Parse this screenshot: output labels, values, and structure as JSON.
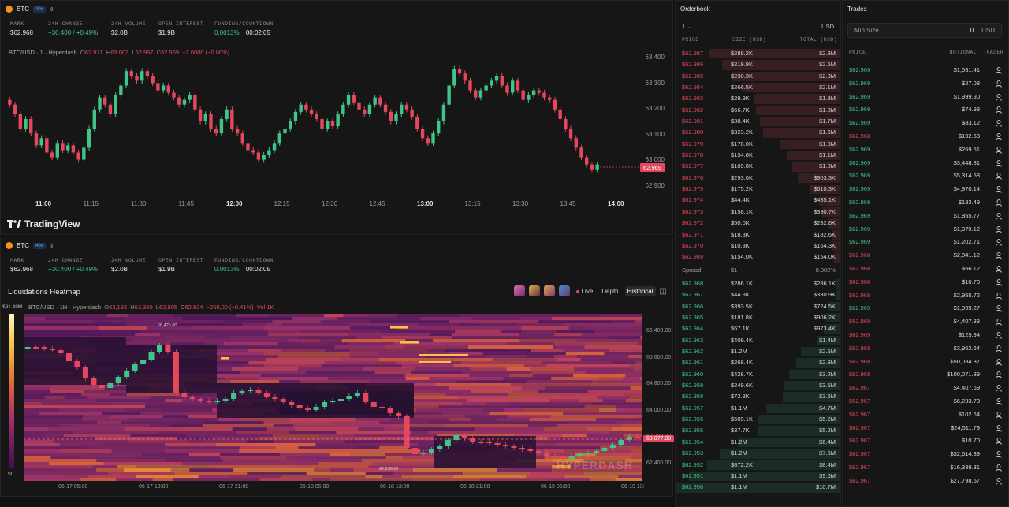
{
  "chart1": {
    "symbol": "BTC",
    "leverage": "40x",
    "stats": [
      {
        "label": "MARK",
        "value": "$62.968",
        "color": "white"
      },
      {
        "label": "24H CHANGE",
        "value": "+30.400 / +0.49%",
        "color": "green"
      },
      {
        "label": "24H VOLUME",
        "value": "$2.0B",
        "color": "white"
      },
      {
        "label": "OPEN INTEREST",
        "value": "$1.9B",
        "color": "white"
      },
      {
        "label": "FUNDING/COUNTDOWN",
        "value": "0.0013%",
        "value2": "00:02:05",
        "color": "green"
      }
    ],
    "ohlc": {
      "name": "BTC/USD · 1 · Hyperdash",
      "o": "62.971",
      "h": "63.003",
      "l": "62.967",
      "c": "62.969",
      "chg": "−2.0000 (−0.00%)"
    },
    "y_ticks": [
      "63.400",
      "63.300",
      "63.200",
      "63.100",
      "63.000",
      "62.900"
    ],
    "x_ticks": [
      "11:00",
      "11:15",
      "11:30",
      "11:45",
      "12:00",
      "12:15",
      "12:30",
      "12:45",
      "13:00",
      "13:15",
      "13:30",
      "13:45",
      "14:00"
    ],
    "price_tag": "62.969",
    "brand": "TradingView"
  },
  "chart2": {
    "symbol": "BTC",
    "leverage": "40x",
    "stats": [
      {
        "label": "MARK",
        "value": "$62.968",
        "color": "white"
      },
      {
        "label": "24H CHANGE",
        "value": "+30.400 / +0.49%",
        "color": "green"
      },
      {
        "label": "24H VOLUME",
        "value": "$2.0B",
        "color": "white"
      },
      {
        "label": "OPEN INTEREST",
        "value": "$1.9B",
        "color": "white"
      },
      {
        "label": "FUNDING/COUNTDOWN",
        "value": "0.0013%",
        "value2": "00:02:05",
        "color": "green"
      }
    ],
    "title": "Liquidations Heatmap",
    "controls": {
      "live": "Live",
      "depth": "Depth",
      "historical": "Historical"
    },
    "ohlc": {
      "name": "BTC/USD · 1H · Hyperdash",
      "o": "63,183",
      "h": "63,380",
      "l": "62,905",
      "c": "62,924",
      "chg": "−259,00 (−0.41%)",
      "vol": "Vol 1K"
    },
    "scale_max": "$91.49M",
    "scale_min": "$0",
    "y_ticks": [
      "66,400.00",
      "65,600.00",
      "64,800.00",
      "64,000.00",
      "63,200.00",
      "62,400.00"
    ],
    "price_tag": "63,077.00",
    "x_ticks": [
      "06-17 05:00",
      "06-17 13:00",
      "06-17 21:00",
      "06-18 05:00",
      "06-18 13:00",
      "06-18 21:00",
      "06-19 05:00",
      "06-19 13:"
    ],
    "hi_label": "66,425.00",
    "lo_label": "62,236.00",
    "watermark": "HYPERDASH"
  },
  "orderbook": {
    "title": "Orderbook",
    "group": "1",
    "unit": "USD",
    "headers": {
      "price": "PRICE",
      "size": "SIZE (USD)",
      "total": "TOTAL (USD)"
    },
    "asks": [
      {
        "price": "$62.987",
        "size": "$288.2K",
        "total": "$2.8M",
        "depth": 0.8
      },
      {
        "price": "$62.986",
        "size": "$219.9K",
        "total": "$2.5M",
        "depth": 0.72
      },
      {
        "price": "$62.985",
        "size": "$230.3K",
        "total": "$2.3M",
        "depth": 0.66
      },
      {
        "price": "$62.984",
        "size": "$266.5K",
        "total": "$2.1M",
        "depth": 0.6
      },
      {
        "price": "$62.983",
        "size": "$29.9K",
        "total": "$1.8M",
        "depth": 0.52
      },
      {
        "price": "$62.982",
        "size": "$66.7K",
        "total": "$1.8M",
        "depth": 0.51
      },
      {
        "price": "$62.981",
        "size": "$38.4K",
        "total": "$1.7M",
        "depth": 0.49
      },
      {
        "price": "$62.980",
        "size": "$323.2K",
        "total": "$1.6M",
        "depth": 0.47
      },
      {
        "price": "$62.979",
        "size": "$178.0K",
        "total": "$1.3M",
        "depth": 0.37
      },
      {
        "price": "$62.978",
        "size": "$134.8K",
        "total": "$1.1M",
        "depth": 0.32
      },
      {
        "price": "$62.977",
        "size": "$109.8K",
        "total": "$1.0M",
        "depth": 0.29
      },
      {
        "price": "$62.976",
        "size": "$293.0K",
        "total": "$903.3K",
        "depth": 0.26
      },
      {
        "price": "$62.975",
        "size": "$175.2K",
        "total": "$610.3K",
        "depth": 0.18
      },
      {
        "price": "$62.974",
        "size": "$44.4K",
        "total": "$435.1K",
        "depth": 0.13
      },
      {
        "price": "$62.973",
        "size": "$158.1K",
        "total": "$390.7K",
        "depth": 0.11
      },
      {
        "price": "$62.972",
        "size": "$50.0K",
        "total": "$232.6K",
        "depth": 0.07
      },
      {
        "price": "$62.971",
        "size": "$18.3K",
        "total": "$182.6K",
        "depth": 0.05
      },
      {
        "price": "$62.970",
        "size": "$10.3K",
        "total": "$164.3K",
        "depth": 0.05
      },
      {
        "price": "$62.969",
        "size": "$154.0K",
        "total": "$154.0K",
        "depth": 0.04
      }
    ],
    "spread": {
      "label": "Spread",
      "value": "$1",
      "pct": "0.002%"
    },
    "bids": [
      {
        "price": "$62.968",
        "size": "$286.1K",
        "total": "$286.1K",
        "depth": 0.03
      },
      {
        "price": "$62.967",
        "size": "$44.8K",
        "total": "$330.9K",
        "depth": 0.03
      },
      {
        "price": "$62.966",
        "size": "$393.5K",
        "total": "$724.5K",
        "depth": 0.07
      },
      {
        "price": "$62.965",
        "size": "$181.8K",
        "total": "$906.2K",
        "depth": 0.09
      },
      {
        "price": "$62.964",
        "size": "$67.1K",
        "total": "$973.4K",
        "depth": 0.1
      },
      {
        "price": "$62.963",
        "size": "$409.4K",
        "total": "$1.4M",
        "depth": 0.14
      },
      {
        "price": "$62.962",
        "size": "$1.2M",
        "total": "$2.5M",
        "depth": 0.24
      },
      {
        "price": "$62.961",
        "size": "$268.4K",
        "total": "$2.8M",
        "depth": 0.27
      },
      {
        "price": "$62.960",
        "size": "$428.7K",
        "total": "$3.2M",
        "depth": 0.31
      },
      {
        "price": "$62.959",
        "size": "$249.6K",
        "total": "$3.5M",
        "depth": 0.34
      },
      {
        "price": "$62.958",
        "size": "$72.8K",
        "total": "$3.6M",
        "depth": 0.35
      },
      {
        "price": "$62.957",
        "size": "$1.1M",
        "total": "$4.7M",
        "depth": 0.45
      },
      {
        "price": "$62.956",
        "size": "$509.1K",
        "total": "$5.2M",
        "depth": 0.5
      },
      {
        "price": "$62.955",
        "size": "$37.7K",
        "total": "$5.2M",
        "depth": 0.5
      },
      {
        "price": "$62.954",
        "size": "$1.2M",
        "total": "$6.4M",
        "depth": 0.62
      },
      {
        "price": "$62.953",
        "size": "$1.2M",
        "total": "$7.6M",
        "depth": 0.73
      },
      {
        "price": "$62.952",
        "size": "$872.2K",
        "total": "$8.4M",
        "depth": 0.81
      },
      {
        "price": "$62.951",
        "size": "$1.1M",
        "total": "$9.6M",
        "depth": 0.92
      },
      {
        "price": "$62.950",
        "size": "$1.1M",
        "total": "$10.7M",
        "depth": 1.0
      }
    ]
  },
  "trades": {
    "title": "Trades",
    "min_size_label": "Min Size",
    "min_size_value": "0",
    "min_size_unit": "USD",
    "headers": {
      "price": "PRICE",
      "notional": "NOTIONAL",
      "trader": "TRADER"
    },
    "rows": [
      {
        "price": "$62.969",
        "notional": "$1,531.41",
        "side": "buy"
      },
      {
        "price": "$62.969",
        "notional": "$27.08",
        "side": "buy"
      },
      {
        "price": "$62.969",
        "notional": "$1,999.90",
        "side": "buy"
      },
      {
        "price": "$62.969",
        "notional": "$74.93",
        "side": "buy"
      },
      {
        "price": "$62.969",
        "notional": "$83.12",
        "side": "buy"
      },
      {
        "price": "$62.968",
        "notional": "$192.68",
        "side": "sell"
      },
      {
        "price": "$62.969",
        "notional": "$269.51",
        "side": "buy"
      },
      {
        "price": "$62.969",
        "notional": "$3,448.81",
        "side": "buy"
      },
      {
        "price": "$62.969",
        "notional": "$5,314.58",
        "side": "buy"
      },
      {
        "price": "$62.969",
        "notional": "$4,970.14",
        "side": "buy"
      },
      {
        "price": "$62.969",
        "notional": "$133.49",
        "side": "buy"
      },
      {
        "price": "$62.969",
        "notional": "$1,865.77",
        "side": "buy"
      },
      {
        "price": "$62.969",
        "notional": "$1,979.12",
        "side": "buy"
      },
      {
        "price": "$62.969",
        "notional": "$1,202.71",
        "side": "buy"
      },
      {
        "price": "$62.968",
        "notional": "$2,841.12",
        "side": "sell"
      },
      {
        "price": "$62.968",
        "notional": "$66.12",
        "side": "sell"
      },
      {
        "price": "$62.968",
        "notional": "$10.70",
        "side": "sell"
      },
      {
        "price": "$62.968",
        "notional": "$2,955.72",
        "side": "sell"
      },
      {
        "price": "$62.969",
        "notional": "$1,999.27",
        "side": "buy"
      },
      {
        "price": "$62.969",
        "notional": "$4,407.83",
        "side": "sell"
      },
      {
        "price": "$62.969",
        "notional": "$125.94",
        "side": "sell"
      },
      {
        "price": "$62.968",
        "notional": "$3,962.64",
        "side": "sell"
      },
      {
        "price": "$62.968",
        "notional": "$50,034.37",
        "side": "sell"
      },
      {
        "price": "$62.968",
        "notional": "$100,071.89",
        "side": "sell"
      },
      {
        "price": "$62.967",
        "notional": "$4,407.69",
        "side": "sell"
      },
      {
        "price": "$62.967",
        "notional": "$6,233.73",
        "side": "sell"
      },
      {
        "price": "$62.967",
        "notional": "$102.64",
        "side": "sell"
      },
      {
        "price": "$62.967",
        "notional": "$24,511.79",
        "side": "sell"
      },
      {
        "price": "$62.967",
        "notional": "$10.70",
        "side": "sell"
      },
      {
        "price": "$62.967",
        "notional": "$32,614.39",
        "side": "sell"
      },
      {
        "price": "$62.967",
        "notional": "$16,339.31",
        "side": "sell"
      },
      {
        "price": "$62.967",
        "notional": "$27,798.67",
        "side": "sell"
      }
    ]
  },
  "colors": {
    "green": "#3fc48a",
    "red": "#e5485e",
    "btc": "#f7931a"
  }
}
